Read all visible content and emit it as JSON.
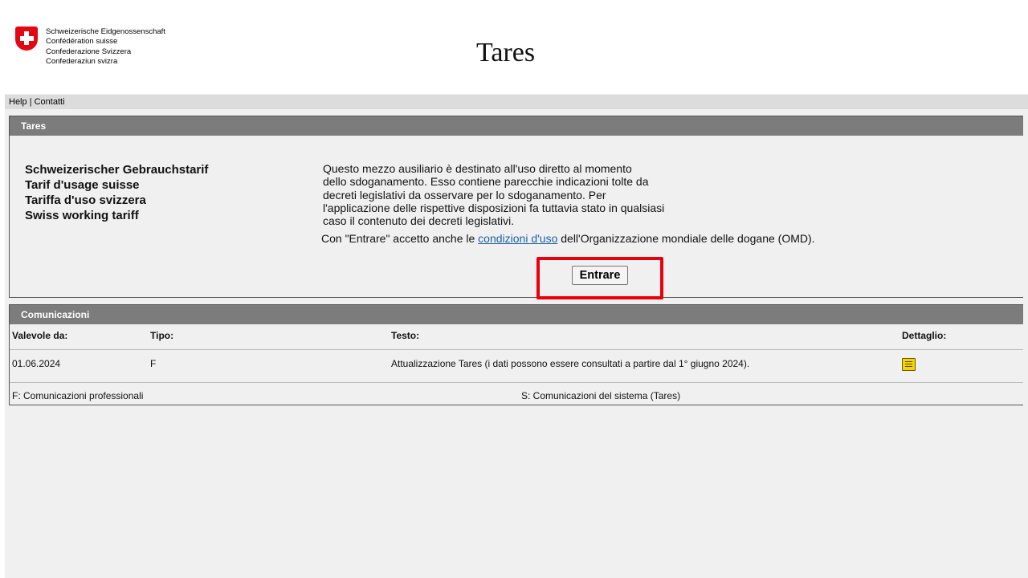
{
  "header": {
    "logo_lines": [
      "Schweizerische Eidgenossenschaft",
      "Confédération suisse",
      "Confederazione Svizzera",
      "Confederaziun svizra"
    ],
    "title": "Tares"
  },
  "nav": {
    "help": "Help",
    "separator": "|",
    "contacts": "Contatti"
  },
  "tares_panel": {
    "header": "Tares",
    "tariff_names": [
      "Schweizerischer Gebrauchstarif",
      "Tarif d'usage suisse",
      "Tariffa d'uso svizzera",
      "Swiss working tariff"
    ],
    "description_lines": [
      "Questo mezzo ausiliario è destinato all'uso diretto al momento",
      "dello sdoganamento. Esso contiene parecchie indicazioni tolte da",
      "decreti legislativi da osservare per lo sdoganamento. Per",
      "l'applicazione delle rispettive disposizioni fa tuttavia stato in qualsiasi",
      "caso il contenuto dei decreti legislativi."
    ],
    "accept_prefix": "Con \"Entrare\" accetto anche le ",
    "accept_link": "condizioni d'uso",
    "accept_suffix": " dell'Organizzazione mondiale delle dogane (OMD).",
    "enter_button": "Entrare"
  },
  "comm_panel": {
    "header": "Comunicazioni",
    "columns": {
      "valid_from": "Valevole da:",
      "type": "Tipo:",
      "text": "Testo:",
      "detail": "Dettaglio:"
    },
    "rows": [
      {
        "valid_from": "01.06.2024",
        "type": "F",
        "text": "Attualizzazione Tares (i dati possono essere consultati a partire dal 1° giugno 2024)."
      }
    ],
    "legend": {
      "f": "F: Comunicazioni professionali",
      "s": "S: Comunicazioni del sistema (Tares)"
    }
  },
  "colors": {
    "highlight": "#e8000b",
    "panel_header": "#7c7c7c",
    "flag": "#e30613",
    "link": "#1a5fa8"
  },
  "icons": {
    "detail": "document-icon"
  }
}
